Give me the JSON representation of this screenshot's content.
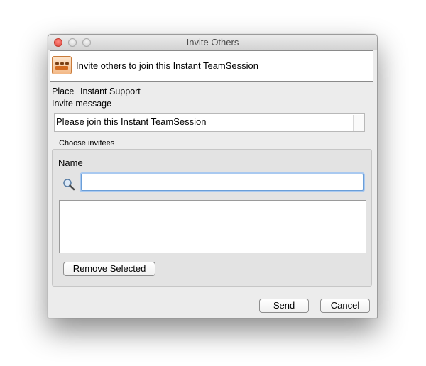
{
  "window": {
    "title": "Invite Others"
  },
  "header": {
    "text": "Invite others to join this Instant TeamSession",
    "icon": "team-session-icon"
  },
  "place": {
    "label": "Place",
    "value": "Instant Support"
  },
  "invite_message": {
    "label": "Invite message",
    "value": "Please join this Instant TeamSession"
  },
  "invitees": {
    "section_label": "Choose invitees",
    "name_label": "Name",
    "name_value": "",
    "search_icon": "search-icon",
    "items": []
  },
  "buttons": {
    "remove_selected": "Remove Selected",
    "send": "Send",
    "cancel": "Cancel"
  }
}
